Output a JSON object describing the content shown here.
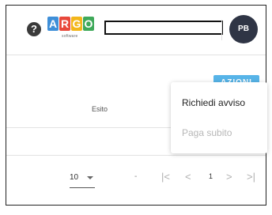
{
  "header": {
    "help_icon": "question-circle-icon",
    "logo": {
      "letters": [
        "A",
        "R",
        "G",
        "O"
      ],
      "subtitle": "software"
    },
    "avatar_initials": "PB",
    "colors": {
      "logo": [
        "#3f8fd8",
        "#e8483b",
        "#f3b61a",
        "#3fa95a"
      ],
      "avatar": "#2f3545"
    }
  },
  "toolbar": {
    "azioni_label": "AZIONI",
    "color": "#57b4e8"
  },
  "table": {
    "column_header": "Esito"
  },
  "pagination": {
    "page_size": "10",
    "range": "-",
    "current_page": "1",
    "first": "|<",
    "prev": "<",
    "next": ">",
    "last": ">|"
  },
  "menu": {
    "items": [
      {
        "label": "Richiedi avviso"
      },
      {
        "label": "Paga subito"
      }
    ]
  }
}
